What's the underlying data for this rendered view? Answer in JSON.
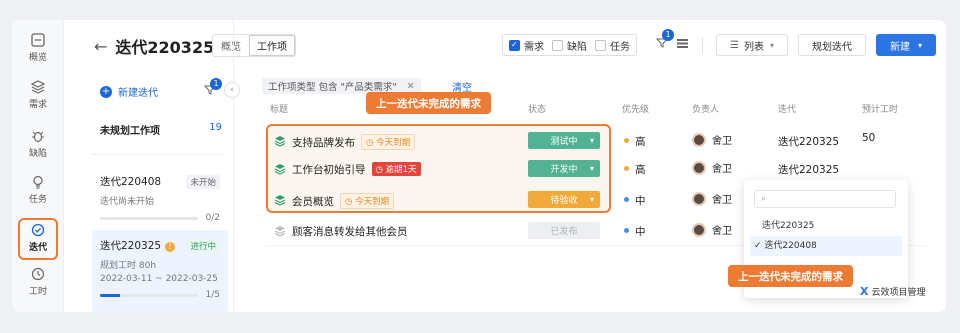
{
  "rail": [
    {
      "label": "概览",
      "icon": "overview-icon"
    },
    {
      "label": "需求",
      "icon": "layers-icon"
    },
    {
      "label": "缺陷",
      "icon": "bug-icon"
    },
    {
      "label": "任务",
      "icon": "bulb-icon"
    },
    {
      "label": "迭代",
      "icon": "iteration-icon",
      "active": true
    },
    {
      "label": "工时",
      "icon": "clock-icon"
    }
  ],
  "header": {
    "back": "←",
    "title": "迭代220325"
  },
  "tabs": {
    "overview": "概览",
    "workitems": "工作项"
  },
  "types": {
    "requirement": "需求",
    "defect": "缺陷",
    "task": "任务"
  },
  "toolbar": {
    "filter_badge": "1",
    "view_label": "列表",
    "plan_label": "规划迭代",
    "new_label": "新建"
  },
  "iter_panel": {
    "new_label": "新建迭代",
    "filter_badge": "1",
    "unplanned_label": "未规划工作项",
    "unplanned_count": "19",
    "items": [
      {
        "name": "迭代220408",
        "status": "未开始",
        "sub": "迭代尚未开始",
        "progress": "0/2"
      },
      {
        "name": "迭代220325",
        "status": "进行中",
        "hours": "规划工时 80h",
        "dates": "2022-03-11 ~ 2022-03-25",
        "progress": "1/5"
      }
    ]
  },
  "filter": {
    "text": "工作项类型 包含 \"产品类需求\"",
    "clear": "清空"
  },
  "columns": {
    "title": "标题",
    "status": "状态",
    "priority": "优先级",
    "owner": "负责人",
    "iteration": "迭代",
    "hours": "预计工时"
  },
  "rows": [
    {
      "name": "支持品牌发布",
      "tag": "今天到期",
      "status": "测试中",
      "priority": "高",
      "owner": "舍卫",
      "iteration": "迭代220325",
      "hours": "50"
    },
    {
      "name": "工作台初始引导",
      "tag": "逾期1天",
      "status": "开发中",
      "priority": "高",
      "owner": "舍卫",
      "iteration": "迭代220325",
      "hours": ""
    },
    {
      "name": "会员概览",
      "tag": "今天到期",
      "status": "待验收",
      "priority": "中",
      "owner": "舍卫",
      "iteration": "",
      "hours": ""
    },
    {
      "name": "顾客消息转发给其他会员",
      "tag": "",
      "status": "已发布",
      "priority": "中",
      "owner": "舍卫",
      "iteration": "",
      "hours": ""
    }
  ],
  "callouts": {
    "top": "上一迭代未完成的需求",
    "bottom": "上一迭代未完成的需求"
  },
  "dropdown": {
    "options": [
      "迭代220325",
      "迭代220408"
    ],
    "selected_mark": "✓"
  },
  "brand": {
    "logo": "X",
    "name": "云效项目管理"
  },
  "colors": {
    "accent": "#2b74e2",
    "highlight": "#ee7b34",
    "testing": "#52b394",
    "developing": "#52b394",
    "to_accept": "#f2a93b",
    "released": "#e6e8eb",
    "high": "#f2a93b",
    "medium": "#4a8fe0"
  }
}
